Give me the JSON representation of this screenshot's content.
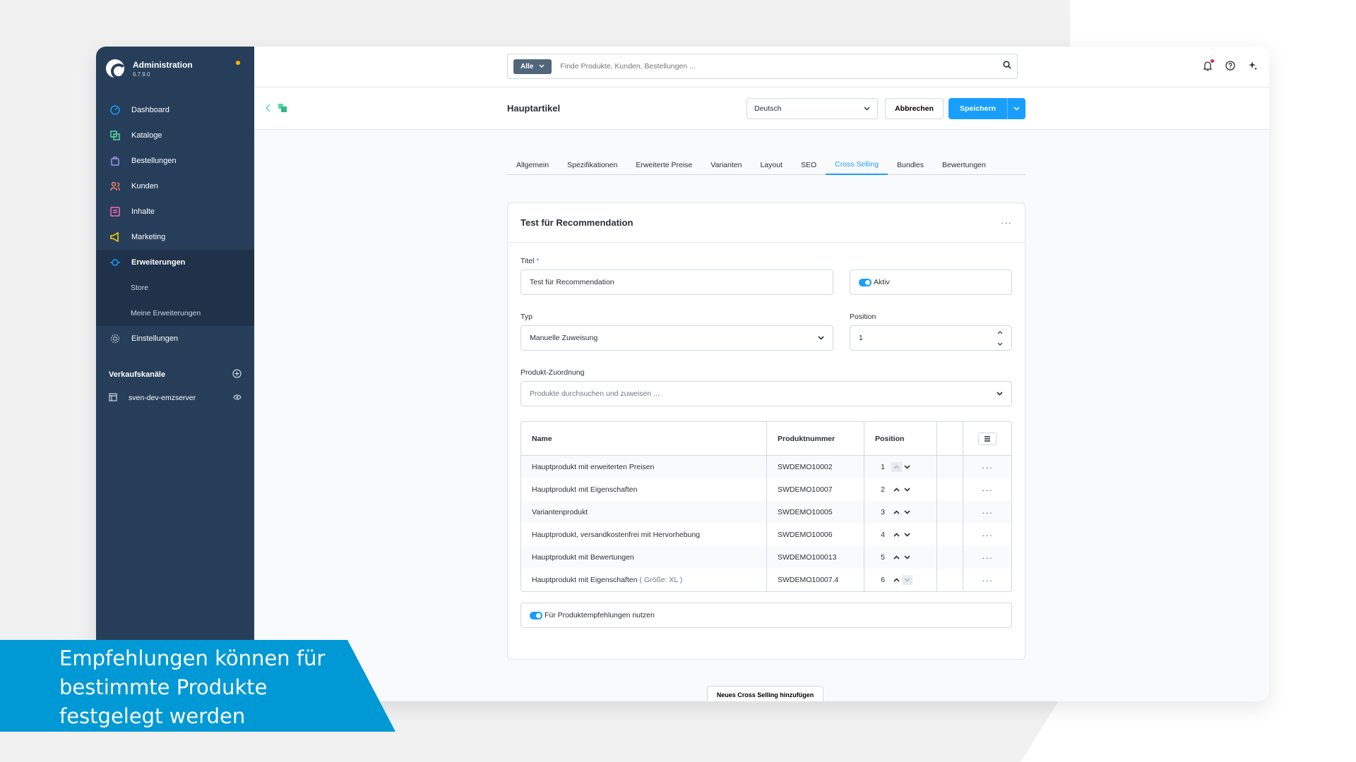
{
  "colors": {
    "sidebar": "#273e5a",
    "accent": "#189eff",
    "caption_bg": "#0099d6"
  },
  "sidebar": {
    "title": "Administration",
    "version": "6.7.9.0",
    "items": [
      {
        "label": "Dashboard",
        "icon": "dashboard-gauge-icon"
      },
      {
        "label": "Kataloge",
        "icon": "catalog-icon"
      },
      {
        "label": "Bestellungen",
        "icon": "shopping-bag-icon"
      },
      {
        "label": "Kunden",
        "icon": "customers-icon"
      },
      {
        "label": "Inhalte",
        "icon": "content-icon"
      },
      {
        "label": "Marketing",
        "icon": "megaphone-icon"
      },
      {
        "label": "Erweiterungen",
        "icon": "plug-icon"
      },
      {
        "label": "Einstellungen",
        "icon": "gear-icon"
      }
    ],
    "subitems": [
      "Store",
      "Meine Erweiterungen"
    ],
    "sales_channels_label": "Verkaufskanäle",
    "channel": "sven-dev-emzserver"
  },
  "search": {
    "scope": "Alle",
    "placeholder": "Finde Produkte, Kunden, Bestellungen ..."
  },
  "smartbar": {
    "title": "Hauptartikel",
    "language": "Deutsch",
    "cancel": "Abbrechen",
    "save": "Speichern"
  },
  "tabs": [
    "Allgemein",
    "Spezifikationen",
    "Erweiterte Preise",
    "Varianten",
    "Layout",
    "SEO",
    "Cross Selling",
    "Bundles",
    "Bewertungen"
  ],
  "active_tab": "Cross Selling",
  "card": {
    "title": "Test für Recommendation",
    "title_label": "Titel",
    "title_required": "*",
    "title_value": "Test für Recommendation",
    "active_label": "Aktiv",
    "type_label": "Typ",
    "type_value": "Manuelle Zuweisung",
    "position_label": "Position",
    "position_value": "1",
    "assign_label": "Produkt-Zuordnung",
    "assign_placeholder": "Produkte durchsuchen und zuweisen ...",
    "recommend_toggle": "Für Produktempfehlungen nutzen"
  },
  "table": {
    "columns": [
      "Name",
      "Produktnummer",
      "Position"
    ],
    "rows": [
      {
        "name": "Hauptprodukt mit erweiterten Preisen",
        "variant": "",
        "number": "SWDEMO10002",
        "position": "1"
      },
      {
        "name": "Hauptprodukt mit Eigenschaften",
        "variant": "",
        "number": "SWDEMO10007",
        "position": "2"
      },
      {
        "name": "Variantenprodukt",
        "variant": "",
        "number": "SWDEMO10005",
        "position": "3"
      },
      {
        "name": "Hauptprodukt, versandkostenfrei mit Hervorhebung",
        "variant": "",
        "number": "SWDEMO10006",
        "position": "4"
      },
      {
        "name": "Hauptprodukt mit Bewertungen",
        "variant": "",
        "number": "SWDEMO100013",
        "position": "5"
      },
      {
        "name": "Hauptprodukt mit Eigenschaften",
        "variant": "( Größe: XL )",
        "number": "SWDEMO10007.4",
        "position": "6"
      }
    ]
  },
  "add_button": "Neues Cross Selling hinzufügen",
  "caption": "Empfehlungen können für\nbestimmte Produkte\nfestgelegt werden"
}
